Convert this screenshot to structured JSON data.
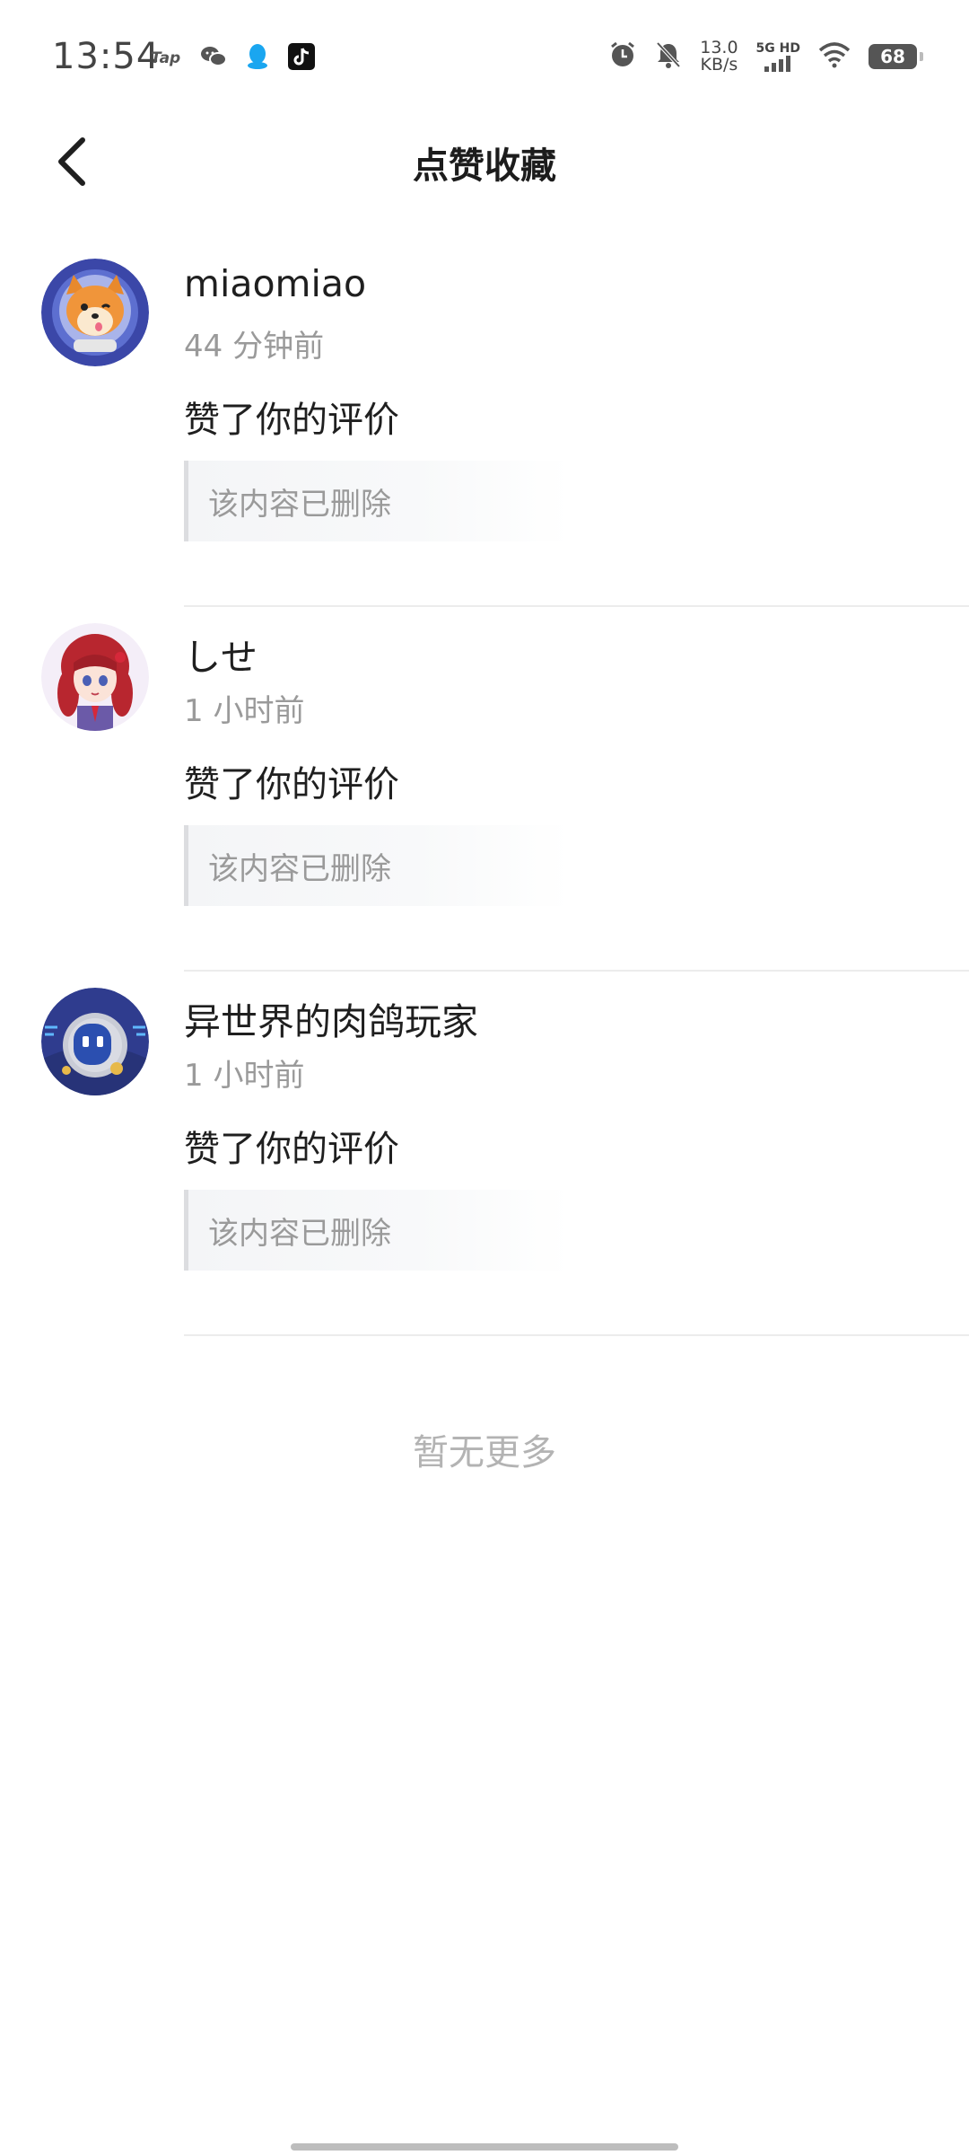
{
  "status_bar": {
    "time": "13:54",
    "apps": [
      "tap-icon",
      "wechat-icon",
      "qq-icon",
      "tiktok-icon"
    ],
    "tap_label": "Tap",
    "speed_value": "13.0",
    "speed_unit": "KB/s",
    "network_type": "5G HD",
    "battery_level": "68"
  },
  "header": {
    "title": "点赞收藏"
  },
  "notifications": [
    {
      "username": "miaomiao",
      "time": "44 分钟前",
      "action": "赞了你的评价",
      "content": "该内容已删除",
      "avatar": "shiba-dog-astronaut-avatar"
    },
    {
      "username": "しせ",
      "time": "1 小时前",
      "action": "赞了你的评价",
      "content": "该内容已删除",
      "avatar": "red-haired-anime-girl-avatar"
    },
    {
      "username": "异世界的肉鸽玩家",
      "time": "1 小时前",
      "action": "赞了你的评价",
      "content": "该内容已删除",
      "avatar": "robot-avatar"
    }
  ],
  "footer": {
    "no_more_text": "暂无更多"
  },
  "colors": {
    "text_primary": "#1f1f1f",
    "text_secondary": "#9a9a9a",
    "divider": "#ececec",
    "quote_border": "#dcdde0"
  }
}
